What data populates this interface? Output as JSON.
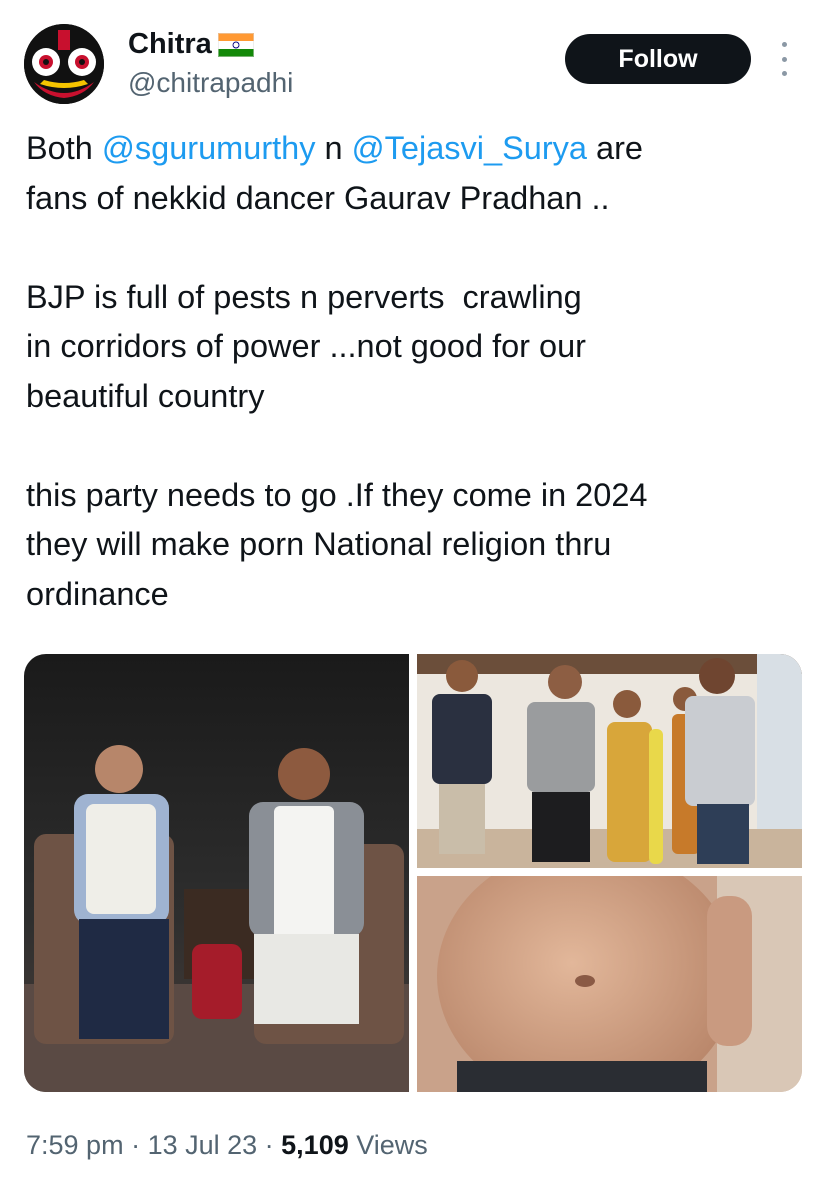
{
  "user": {
    "display_name": "Chitra",
    "flag_icon": "india-flag-icon",
    "handle": "@chitrapadhi",
    "avatar_icon": "avatar-deity-icon"
  },
  "follow_label": "Follow",
  "more_icon": "more-vertical-icon",
  "tweet": {
    "p1_before": "Both ",
    "mention1": "@sgurumurthy",
    "p1_mid": " n ",
    "mention2": "@Tejasvi_Surya",
    "p1_after": " are\nfans of nekkid dancer Gaurav Pradhan ..",
    "p2": "BJP is full of pests n perverts  crawling\nin corridors of power ...not good for our\nbeautiful country",
    "p3": "this party needs to go .If they come in 2024\nthey will make porn National religion thru\nordinance"
  },
  "meta": {
    "time": "7:59 pm",
    "sep1": " · ",
    "date": "13 Jul 23",
    "sep2": " · ",
    "views_count": "5,109",
    "views_label": " Views"
  },
  "colors": {
    "mention": "#1d9bf0",
    "muted": "#536471",
    "text": "#0f1419",
    "button_bg": "#0f1419"
  }
}
